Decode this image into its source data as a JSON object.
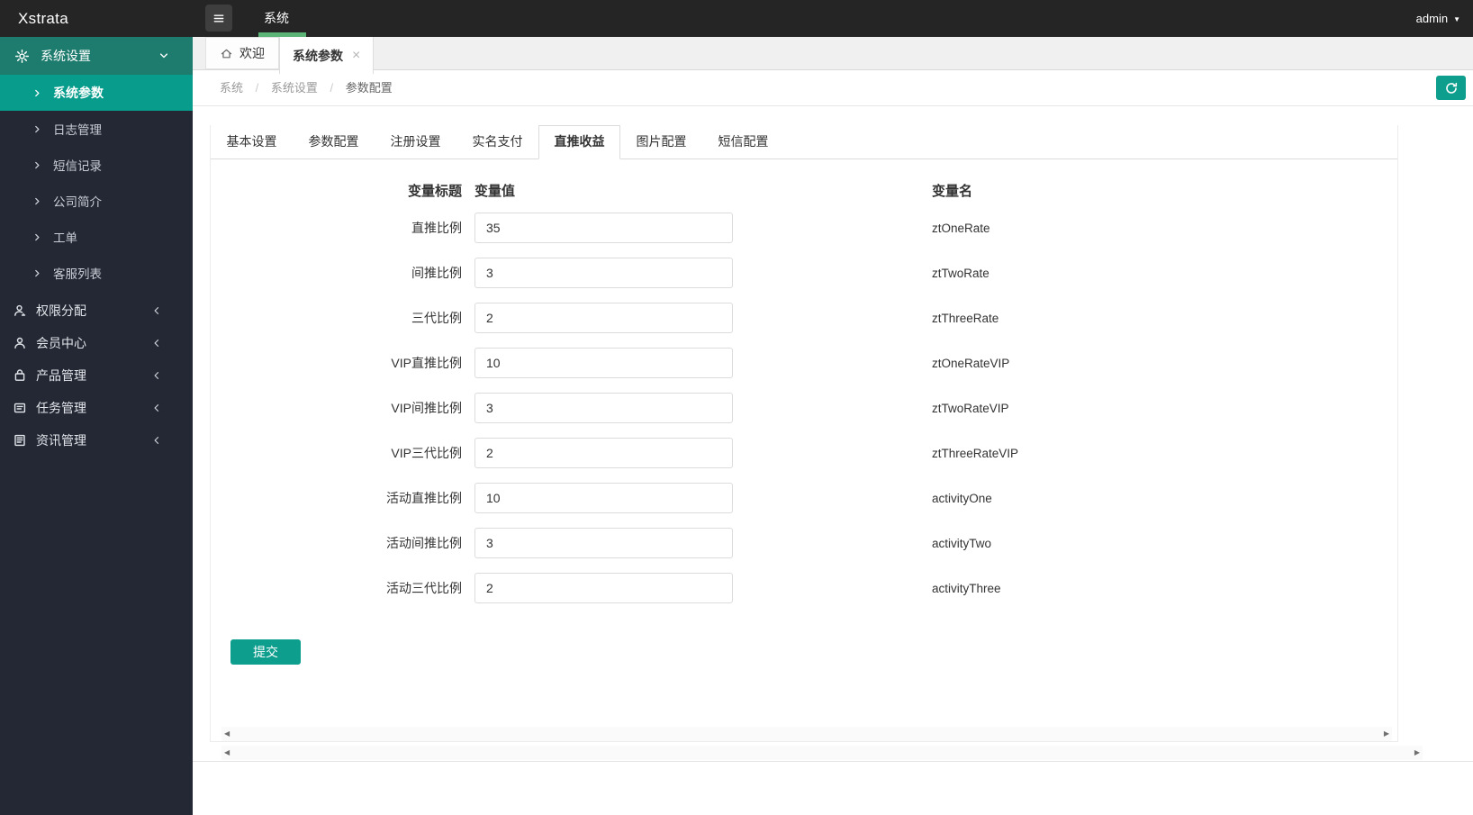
{
  "colors": {
    "accent_teal": "#0e9e8d",
    "sidebar_parent_active": "#1d7c6e",
    "sidebar_child_active": "#079c8b",
    "nav_underline_green": "#5cb576"
  },
  "topbar": {
    "brand": "Xstrata",
    "nav_item": "系统",
    "user": "admin",
    "user_caret": "▼"
  },
  "sidebar": {
    "expanded_group": {
      "label": "系统设置",
      "icon": "gear-icon"
    },
    "submenu": [
      {
        "label": "系统参数",
        "active": true
      },
      {
        "label": "日志管理",
        "active": false
      },
      {
        "label": "短信记录",
        "active": false
      },
      {
        "label": "公司简介",
        "active": false
      },
      {
        "label": "工单",
        "active": false
      },
      {
        "label": "客服列表",
        "active": false
      }
    ],
    "groups": [
      {
        "label": "权限分配",
        "icon": "user-permission-icon"
      },
      {
        "label": "会员中心",
        "icon": "user-icon"
      },
      {
        "label": "产品管理",
        "icon": "product-icon"
      },
      {
        "label": "任务管理",
        "icon": "task-icon"
      },
      {
        "label": "资讯管理",
        "icon": "news-icon"
      }
    ]
  },
  "page_tabs": {
    "home": {
      "label": "欢迎"
    },
    "active": {
      "label": "系统参数",
      "close": "×"
    }
  },
  "breadcrumb": {
    "items": [
      "系统",
      "系统设置",
      "参数配置"
    ],
    "separator": "/"
  },
  "config_tabs": {
    "items": [
      "基本设置",
      "参数配置",
      "注册设置",
      "实名支付",
      "直推收益",
      "图片配置",
      "短信配置"
    ],
    "active_index": 4
  },
  "form": {
    "headers": {
      "title": "变量标题",
      "value": "变量值",
      "name": "变量名"
    },
    "rows": [
      {
        "title": "直推比例",
        "value": "35",
        "name": "ztOneRate"
      },
      {
        "title": "间推比例",
        "value": "3",
        "name": "ztTwoRate"
      },
      {
        "title": "三代比例",
        "value": "2",
        "name": "ztThreeRate"
      },
      {
        "title": "VIP直推比例",
        "value": "10",
        "name": "ztOneRateVIP"
      },
      {
        "title": "VIP间推比例",
        "value": "3",
        "name": "ztTwoRateVIP"
      },
      {
        "title": "VIP三代比例",
        "value": "2",
        "name": "ztThreeRateVIP"
      },
      {
        "title": "活动直推比例",
        "value": "10",
        "name": "activityOne"
      },
      {
        "title": "活动间推比例",
        "value": "3",
        "name": "activityTwo"
      },
      {
        "title": "活动三代比例",
        "value": "2",
        "name": "activityThree"
      }
    ],
    "submit_label": "提交"
  },
  "scrollbars": {
    "left_arrow": "◀",
    "right_arrow": "▶"
  }
}
